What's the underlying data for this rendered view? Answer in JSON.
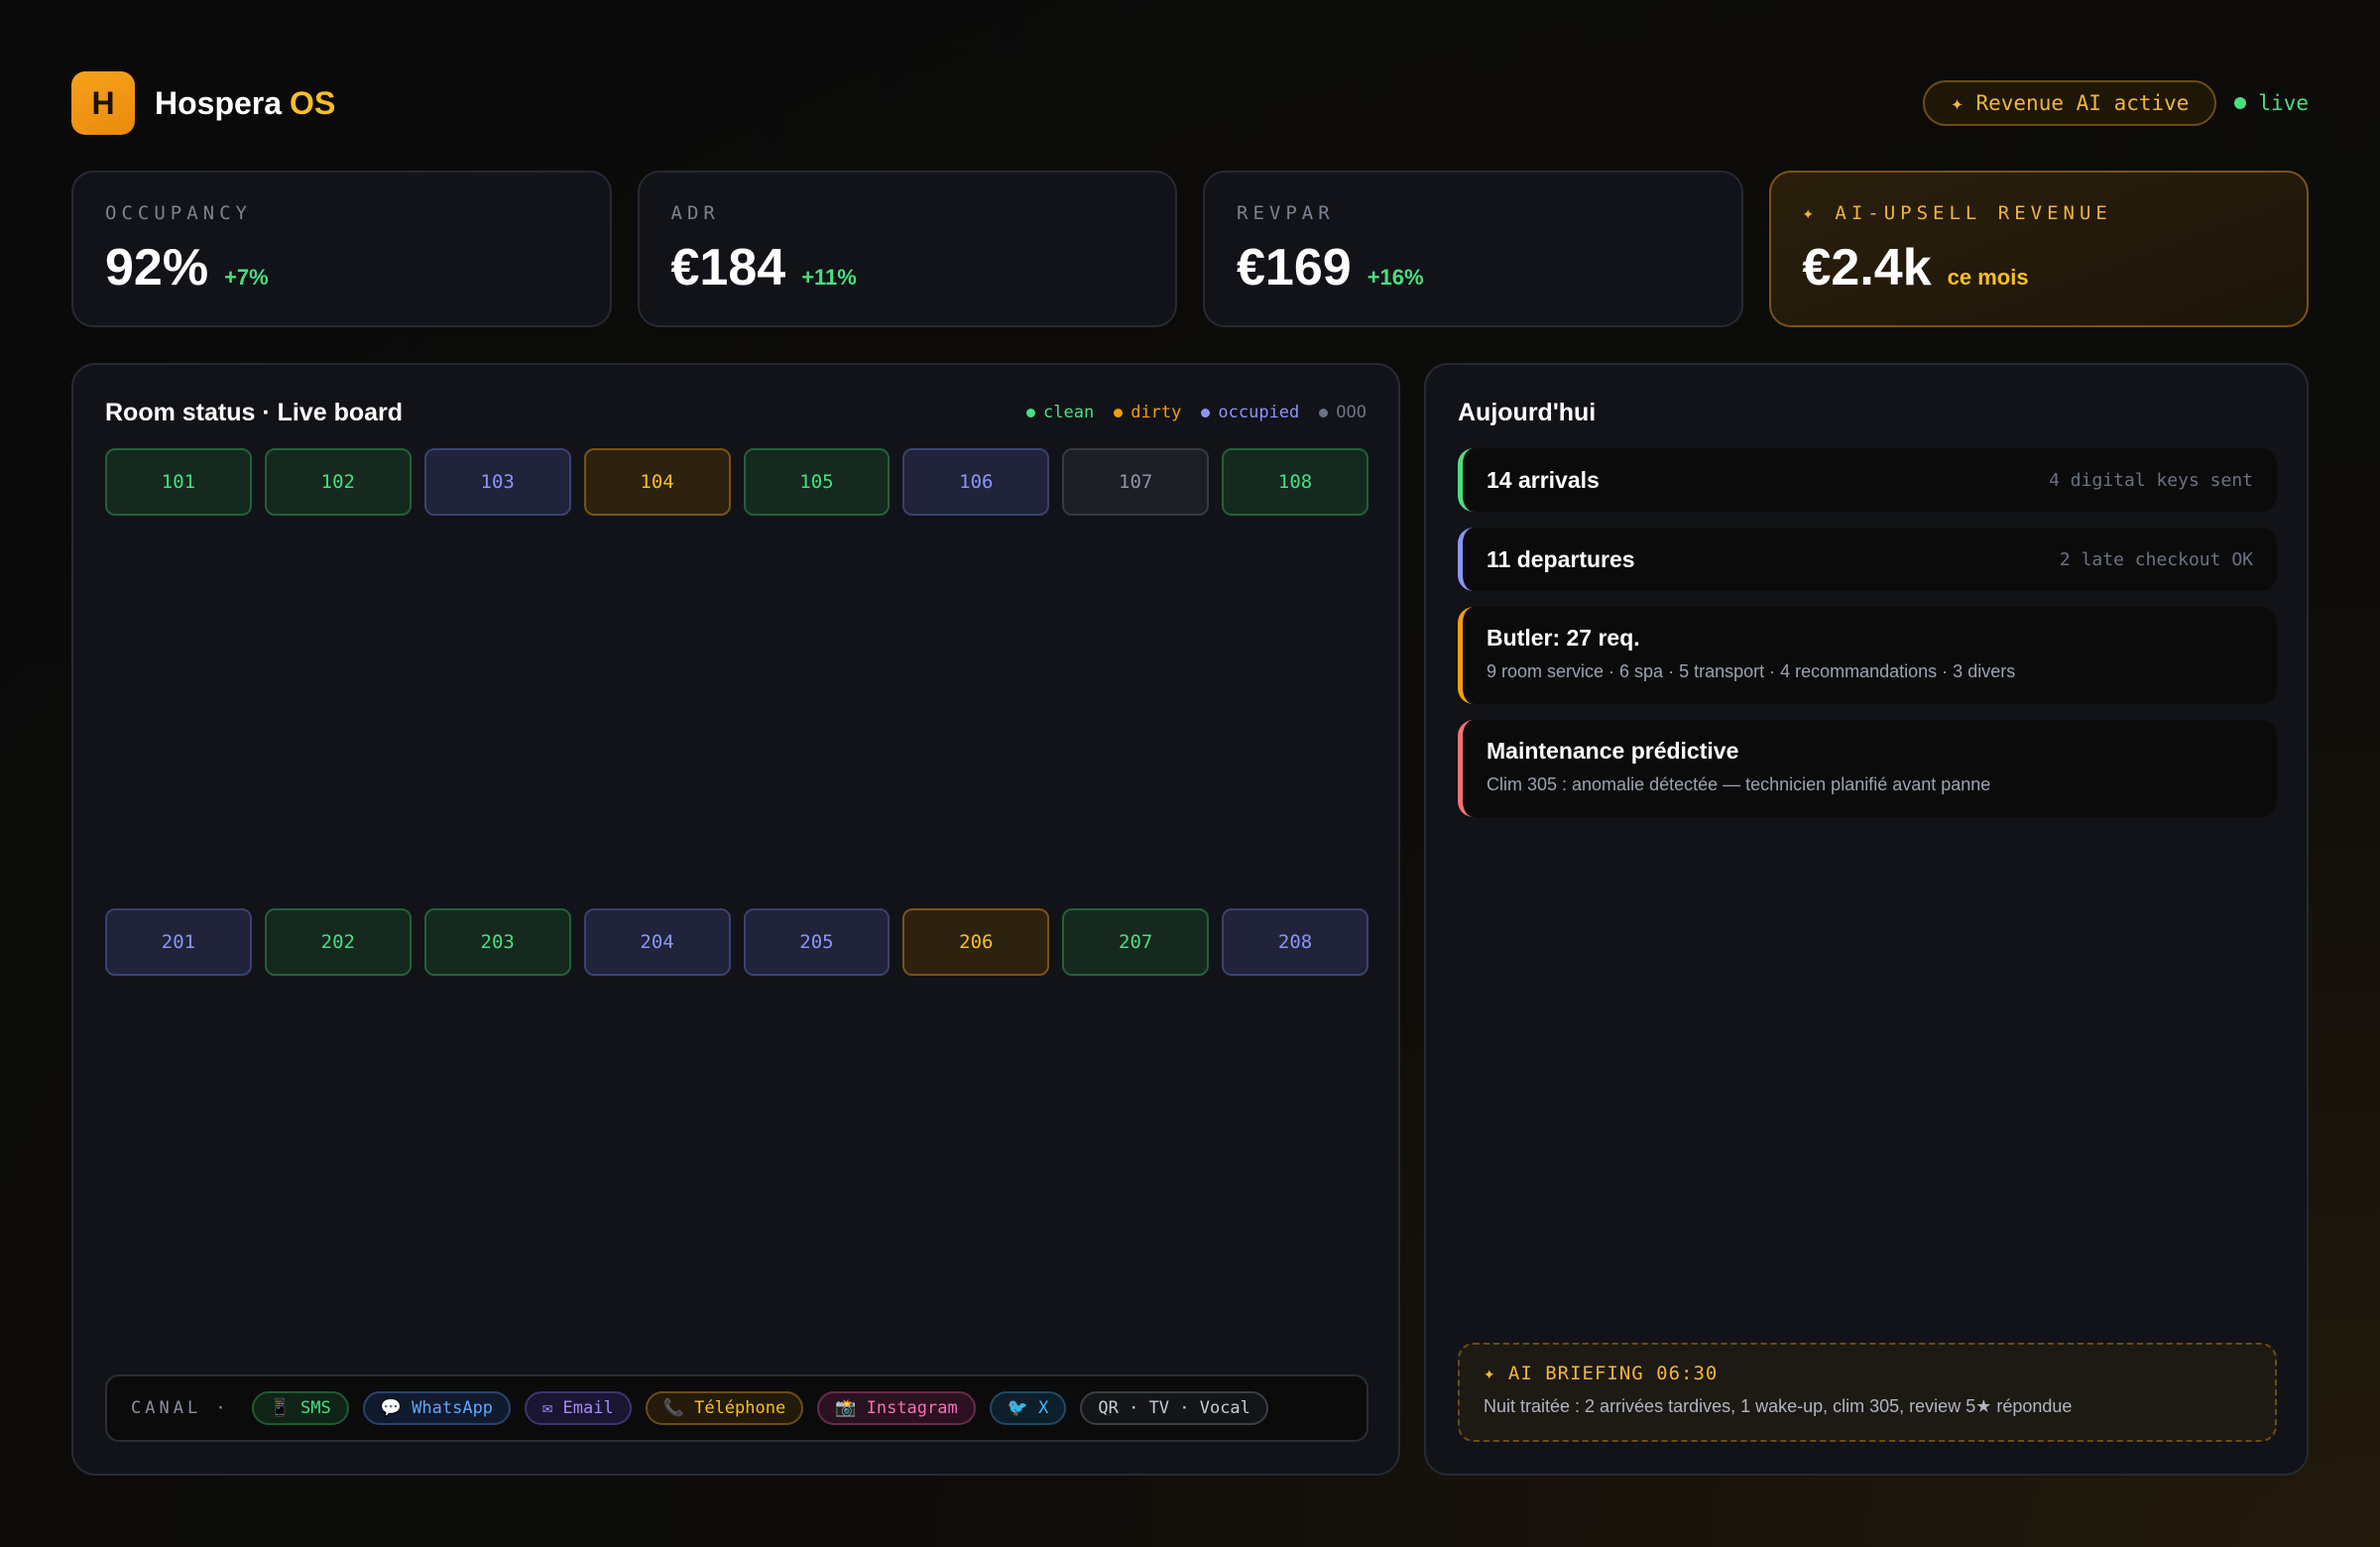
{
  "brand": {
    "logo_letter": "H",
    "name": "Hospera",
    "accent": "OS"
  },
  "header": {
    "ai_pill": "✦ Revenue AI active",
    "live": "live"
  },
  "kpis": [
    {
      "label": "OCCUPANCY",
      "value": "92%",
      "delta": "+7%"
    },
    {
      "label": "ADR",
      "value": "€184",
      "delta": "+11%"
    },
    {
      "label": "REVPAR",
      "value": "€169",
      "delta": "+16%"
    },
    {
      "label": "✦ AI-UPSELL REVENUE",
      "value": "€2.4k",
      "delta": "ce mois"
    }
  ],
  "board": {
    "title": "Room status · Live board",
    "legend": [
      {
        "label": "clean",
        "color": "#4ade80"
      },
      {
        "label": "dirty",
        "color": "#f59e0b"
      },
      {
        "label": "occupied",
        "color": "#8b95f5"
      },
      {
        "label": "OOO",
        "color": "#6b7280"
      }
    ],
    "floor1": [
      {
        "number": "101",
        "status": "clean"
      },
      {
        "number": "102",
        "status": "clean"
      },
      {
        "number": "103",
        "status": "occupied"
      },
      {
        "number": "104",
        "status": "dirty"
      },
      {
        "number": "105",
        "status": "clean"
      },
      {
        "number": "106",
        "status": "occupied"
      },
      {
        "number": "107",
        "status": "ooo"
      },
      {
        "number": "108",
        "status": "clean"
      }
    ],
    "floor2": [
      {
        "number": "201",
        "status": "occupied"
      },
      {
        "number": "202",
        "status": "clean"
      },
      {
        "number": "203",
        "status": "clean"
      },
      {
        "number": "204",
        "status": "occupied"
      },
      {
        "number": "205",
        "status": "occupied"
      },
      {
        "number": "206",
        "status": "dirty"
      },
      {
        "number": "207",
        "status": "clean"
      },
      {
        "number": "208",
        "status": "occupied"
      }
    ],
    "canal_label": "CANAL ·",
    "channels": [
      {
        "label": "📱 SMS",
        "color": "#4ade80",
        "bg": "#0f2416",
        "border": "#1f5a33"
      },
      {
        "label": "💬 WhatsApp",
        "color": "#60a5fa",
        "bg": "#101a2d",
        "border": "#2a4270"
      },
      {
        "label": "✉ Email",
        "color": "#a78bfa",
        "bg": "#1a1530",
        "border": "#3f3470"
      },
      {
        "label": "📞 Téléphone",
        "color": "#fbbf24",
        "bg": "#231a09",
        "border": "#6b4c15"
      },
      {
        "label": "📸 Instagram",
        "color": "#f472b6",
        "bg": "#2a1220",
        "border": "#6b2a4c"
      },
      {
        "label": "🐦 X",
        "color": "#38bdf8",
        "bg": "#0d1f2b",
        "border": "#1f4a66"
      },
      {
        "label": "QR · TV · Vocal",
        "color": "#c7cbd3",
        "bg": "#141519",
        "border": "#3a3d45"
      }
    ]
  },
  "today": {
    "title": "Aujourd'hui",
    "arrivals": {
      "title": "14 arrivals",
      "note": "4 digital keys sent",
      "color": "#4ade80"
    },
    "departures": {
      "title": "11 departures",
      "note": "2 late checkout OK",
      "color": "#8b95f5"
    },
    "butler": {
      "title": "Butler: 27 req.",
      "sub": "9 room service · 6 spa · 5 transport · 4 recommandations · 3 divers",
      "color": "#f59e0b"
    },
    "maintenance": {
      "title": "Maintenance prédictive",
      "sub": "Clim 305 : anomalie détectée — technicien planifié avant panne",
      "color": "#f87171"
    },
    "briefing": {
      "title": "✦ AI BRIEFING 06:30",
      "text": "Nuit traitée : 2 arrivées tardives, 1 wake-up, clim 305, review 5★ répondue"
    }
  }
}
